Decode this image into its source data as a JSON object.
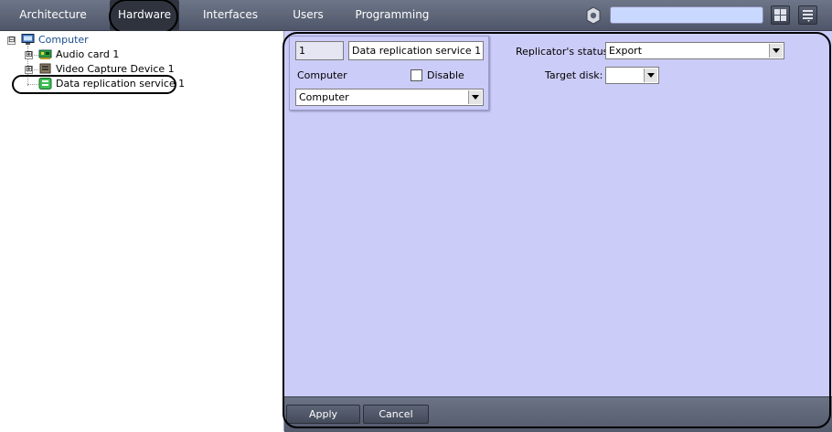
{
  "toolbar": {
    "tabs": [
      {
        "label": "Architecture"
      },
      {
        "label": "Hardware"
      },
      {
        "label": "Interfaces"
      },
      {
        "label": "Users"
      },
      {
        "label": "Programming"
      }
    ],
    "active_tab": "Hardware",
    "search_value": "",
    "icons": [
      "gear-icon",
      "layout-grid-icon",
      "menu-icon"
    ]
  },
  "tree": {
    "root": {
      "label": "Computer",
      "expander": "⊟",
      "icon": "computer-icon"
    },
    "children": [
      {
        "label": "Audio card 1",
        "expander": "⊞",
        "icon": "audio-card-icon"
      },
      {
        "label": "Video Capture Device 1",
        "expander": "⊞",
        "icon": "capture-device-icon"
      },
      {
        "label": "Data replication service 1",
        "icon": "replication-service-icon",
        "selected": true
      }
    ]
  },
  "object_card": {
    "id_value": "1",
    "name_value": "Data replication service 1",
    "parent_label": "Computer",
    "disable_label": "Disable",
    "disable_checked": false,
    "parent_select_value": "Computer"
  },
  "settings": {
    "status_label": "Replicator's status:",
    "status_value": "Export",
    "target_disk_label": "Target disk:",
    "target_disk_value": ""
  },
  "actions": {
    "apply_label": "Apply",
    "cancel_label": "Cancel"
  },
  "colors": {
    "toolbar": "#5a6275",
    "panel": "#ccccf8",
    "search_field": "#c9d8ff",
    "tree_text": "#1a4d8f"
  }
}
